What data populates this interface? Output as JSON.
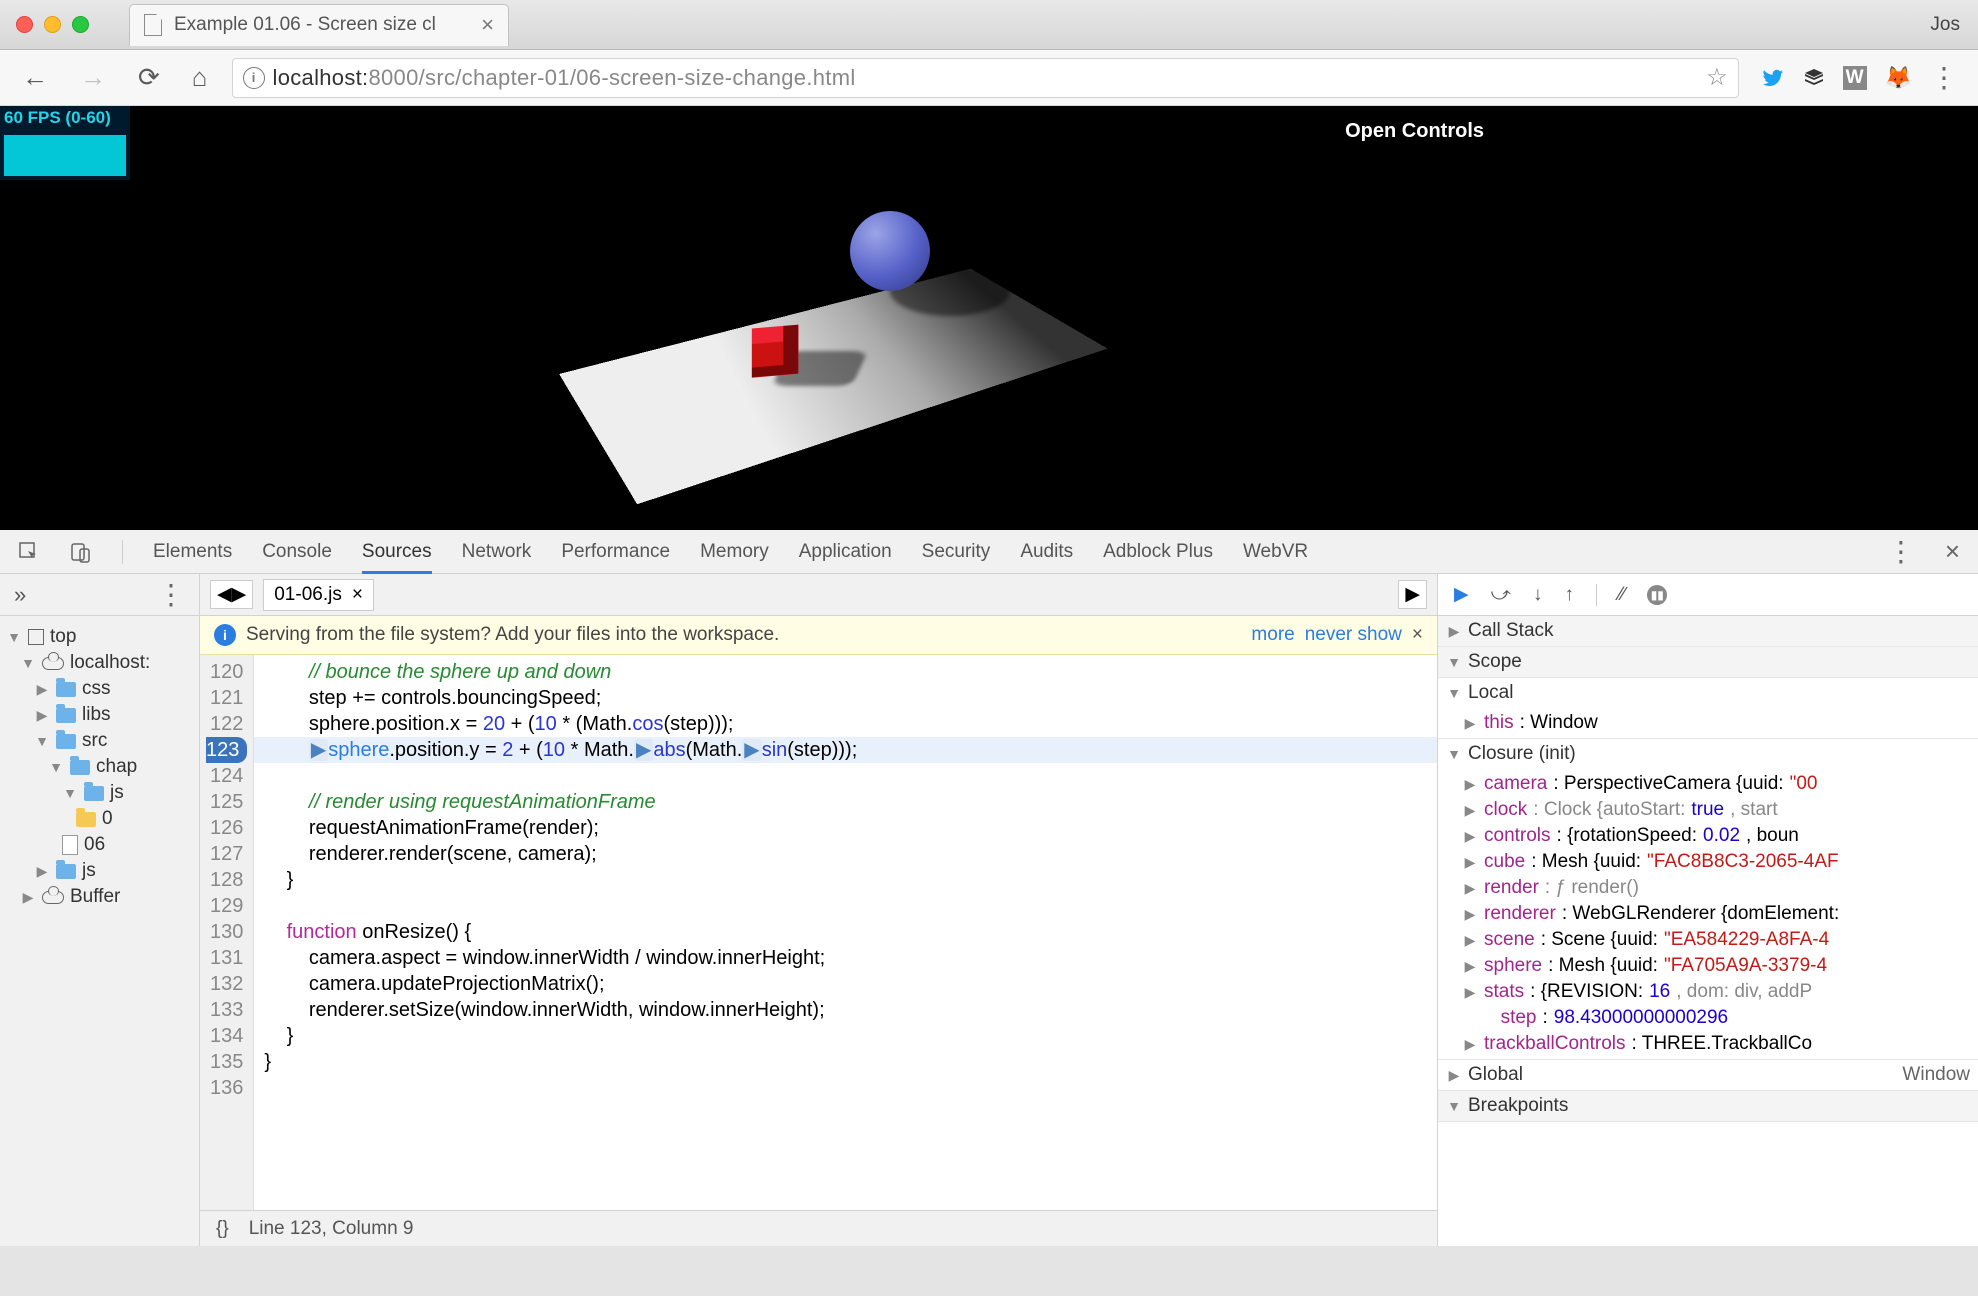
{
  "chrome": {
    "tabTitle": "Example 01.06 - Screen size cl",
    "userName": "Jos",
    "url_info": "ⓘ",
    "url_host": "localhost:",
    "url_port_path": "8000/src/chapter-01/06-screen-size-change.html"
  },
  "viewport": {
    "fps": "60 FPS (0-60)",
    "openControls": "Open Controls"
  },
  "devtools": {
    "tabs": [
      "Elements",
      "Console",
      "Sources",
      "Network",
      "Performance",
      "Memory",
      "Application",
      "Security",
      "Audits",
      "Adblock Plus",
      "WebVR"
    ],
    "activeTab": "Sources",
    "navigator": {
      "top": "top",
      "domain": "localhost:",
      "folders": {
        "css": "css",
        "libs": "libs",
        "src": "src",
        "chap": "chap",
        "js": "js",
        "js2": "js",
        "buffer": "Buffer"
      },
      "file_ext": "0",
      "file_06": "06"
    },
    "fileTab": "01-06.js",
    "banner": {
      "text": "Serving from the file system? Add your files into the workspace.",
      "more": "more",
      "never": "never show"
    },
    "lineNumbers": [
      "120",
      "121",
      "122",
      "123",
      "124",
      "125",
      "126",
      "127",
      "128",
      "129",
      "130",
      "131",
      "132",
      "133",
      "134",
      "135",
      "136"
    ],
    "code": {
      "l120": "// bounce the sphere up and down",
      "l121a": "step += controls.bouncingSpeed;",
      "l122_pre": "sphere.position.x = ",
      "l122_n1": "20",
      "l122_mid": " + (",
      "l122_n2": "10",
      "l122_post": " * (Math.",
      "l122_cos": "cos",
      "l122_end": "(step)));",
      "l123_pre": "sphere",
      "l123_mid1": ".position.y = ",
      "l123_n1": "2",
      "l123_mid2": " + (",
      "l123_n2": "10",
      "l123_mid3": " * Math.",
      "l123_abs": "abs",
      "l123_mid4": "(Math.",
      "l123_sin": "sin",
      "l123_end": "(step)));",
      "l125": "// render using requestAnimationFrame",
      "l126": "requestAnimationFrame(render);",
      "l127": "renderer.render(scene, camera);",
      "l128": "}",
      "l130_kw": "function",
      "l130_name": " onResize() {",
      "l131": "camera.aspect = window.innerWidth / window.innerHeight;",
      "l132": "camera.updateProjectionMatrix();",
      "l133": "renderer.setSize(window.innerWidth, window.innerHeight);",
      "l134": "}",
      "l135": "}"
    },
    "status": {
      "braces": "{}",
      "pos": "Line 123, Column 9"
    },
    "sections": {
      "callstack": "Call Stack",
      "scope": "Scope",
      "local": "Local",
      "closure": "Closure (init)",
      "global": "Global",
      "globalVal": "Window",
      "breakpoints": "Breakpoints"
    },
    "vars": {
      "this_k": "this",
      "this_v": ": Window",
      "camera_k": "camera",
      "camera_v": ": PerspectiveCamera {uuid: ",
      "camera_s": "\"00",
      "clock_k": "clock",
      "clock_v": ": Clock {autoStart: ",
      "clock_b": "true",
      "clock_rest": ", start",
      "controls_k": "controls",
      "controls_v": ": {rotationSpeed: ",
      "controls_n": "0.02",
      "controls_rest": ", boun",
      "cube_k": "cube",
      "cube_v": ": Mesh {uuid: ",
      "cube_s": "\"FAC8B8C3-2065-4AF",
      "render_k": "render",
      "render_v": ": ƒ render()",
      "renderer_k": "renderer",
      "renderer_v": ": WebGLRenderer {domElement:",
      "scene_k": "scene",
      "scene_v": ": Scene {uuid: ",
      "scene_s": "\"EA584229-A8FA-4",
      "sphere_k": "sphere",
      "sphere_v": ": Mesh {uuid: ",
      "sphere_s": "\"FA705A9A-3379-4",
      "stats_k": "stats",
      "stats_v": ": {REVISION: ",
      "stats_n": "16",
      "stats_rest": ", dom: div, addP",
      "step_k": "step",
      "step_sep": ": ",
      "step_v": "98.43000000000296",
      "tbc_k": "trackballControls",
      "tbc_v": ": THREE.TrackballCo"
    }
  }
}
